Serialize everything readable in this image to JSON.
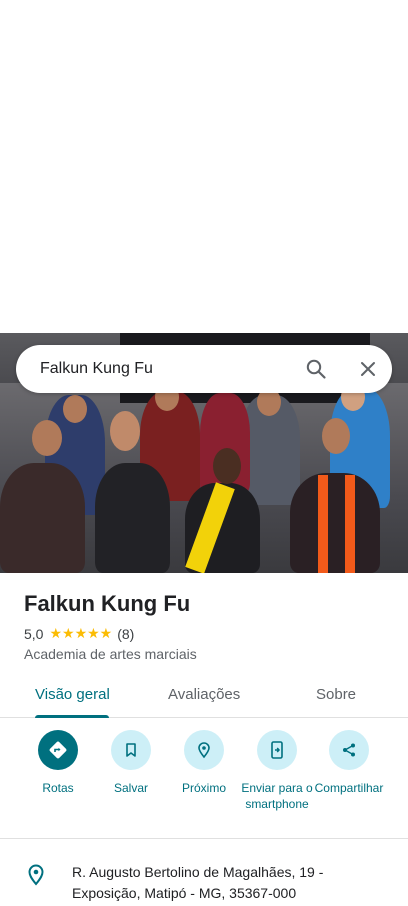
{
  "search": {
    "value": "Falkun Kung Fu",
    "search_icon": "search-icon",
    "close_icon": "close-icon"
  },
  "place": {
    "name": "Falkun Kung Fu",
    "rating": "5,0",
    "stars": "★★★★★",
    "review_count": "(8)",
    "category": "Academia de artes marciais",
    "address": "R. Augusto Bertolino de Magalhães, 19 - Exposição, Matipó - MG, 35367-000"
  },
  "tabs": [
    {
      "label": "Visão geral",
      "active": true
    },
    {
      "label": "Avaliações",
      "active": false
    },
    {
      "label": "Sobre",
      "active": false
    }
  ],
  "actions": [
    {
      "label": "Rotas",
      "icon": "directions-icon"
    },
    {
      "label": "Salvar",
      "icon": "bookmark-icon"
    },
    {
      "label": "Próximo",
      "icon": "nearby-icon"
    },
    {
      "label": "Enviar para o smartphone",
      "icon": "send-to-phone-icon"
    },
    {
      "label": "Compartilhar",
      "icon": "share-icon"
    }
  ],
  "colors": {
    "accent": "#00707f",
    "action_bg": "#cdeff7",
    "star": "#fbbc04"
  }
}
